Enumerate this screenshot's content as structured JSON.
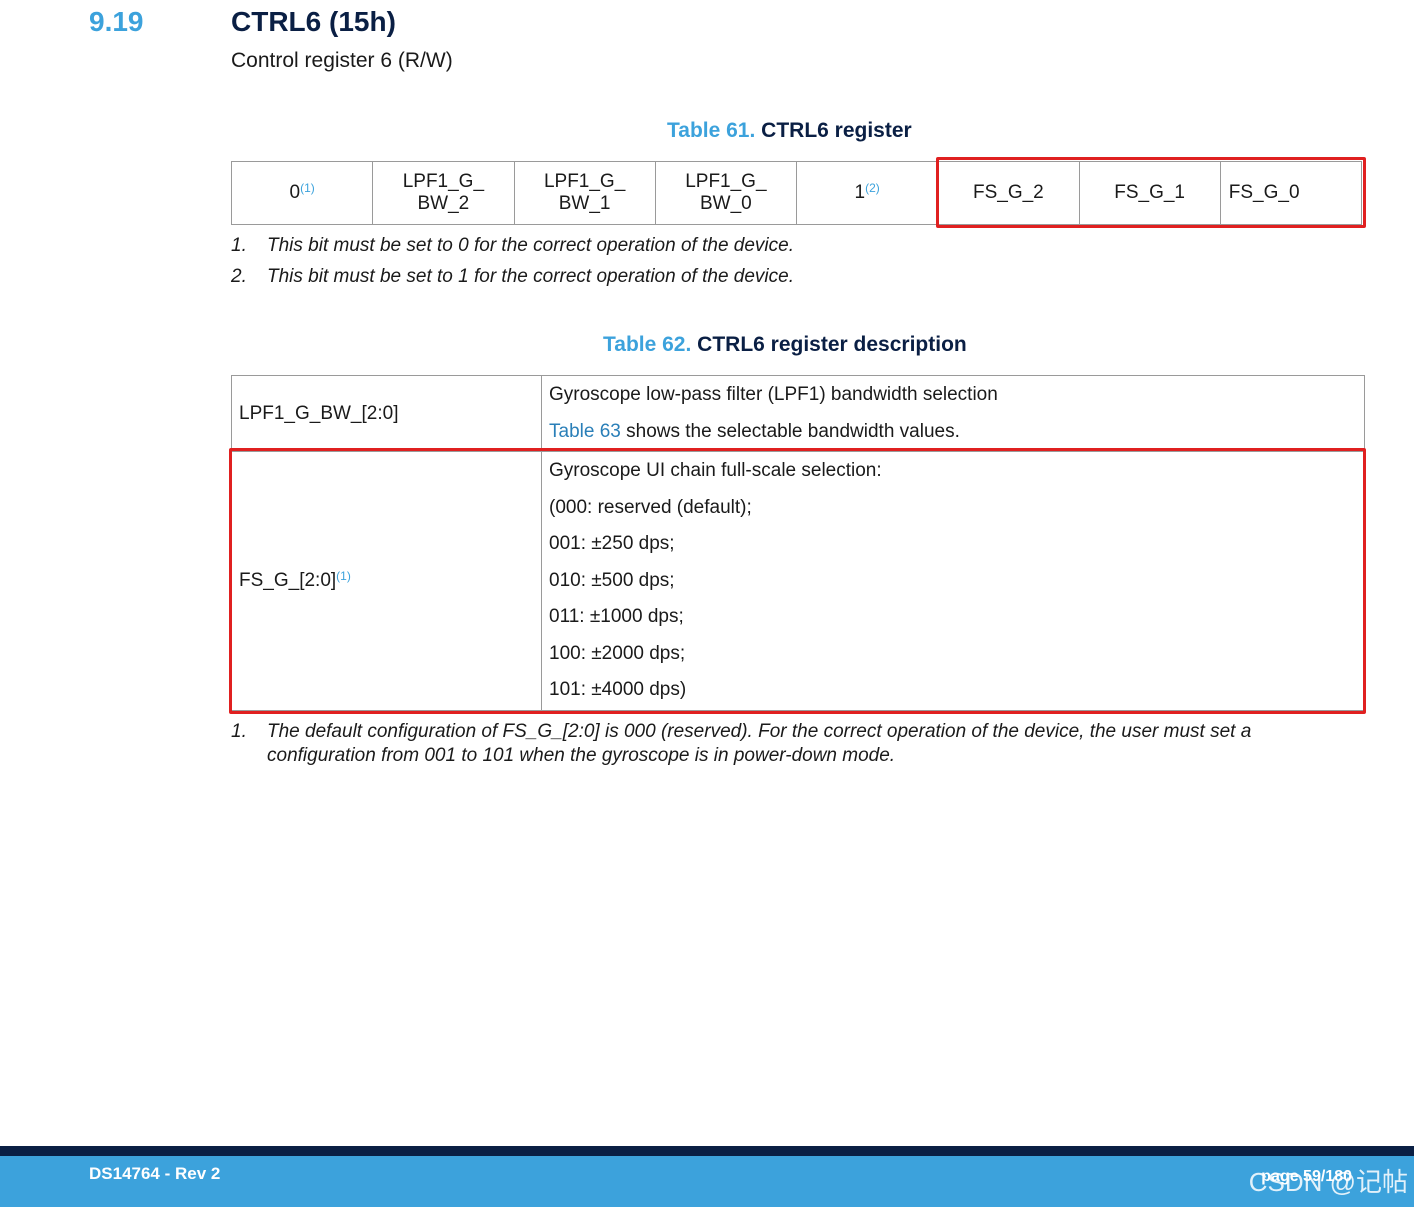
{
  "section": {
    "number": "9.19",
    "title": "CTRL6 (15h)",
    "subtitle": "Control register 6 (R/W)"
  },
  "table61": {
    "caption_num": "Table 61.",
    "caption_text": "CTRL6 register",
    "bits": [
      {
        "line1": "0",
        "line2": "",
        "sup": "(1)"
      },
      {
        "line1": "LPF1_G_",
        "line2": "BW_2",
        "sup": ""
      },
      {
        "line1": "LPF1_G_",
        "line2": "BW_1",
        "sup": ""
      },
      {
        "line1": "LPF1_G_",
        "line2": "BW_0",
        "sup": ""
      },
      {
        "line1": "1",
        "line2": "",
        "sup": "(2)"
      },
      {
        "line1": "FS_G_2",
        "line2": "",
        "sup": ""
      },
      {
        "line1": "FS_G_1",
        "line2": "",
        "sup": ""
      },
      {
        "line1": "FS_G_0",
        "line2": "",
        "sup": ""
      }
    ],
    "notes": [
      {
        "num": "1.",
        "text": "This bit must be set to 0 for the correct operation of the device."
      },
      {
        "num": "2.",
        "text": "This bit must be set to 1 for the correct operation of the device."
      }
    ]
  },
  "table62": {
    "caption_num": "Table 62.",
    "caption_text": "CTRL6 register description",
    "rows": [
      {
        "field": "LPF1_G_BW_[2:0]",
        "field_sup": "",
        "desc_line1": "Gyroscope low-pass filter (LPF1) bandwidth selection",
        "desc_link": "Table 63",
        "desc_line2_rest": " shows the selectable bandwidth values."
      },
      {
        "field": "FS_G_[2:0]",
        "field_sup": "(1)",
        "lines": [
          "Gyroscope UI chain full-scale selection:",
          "(000: reserved (default);",
          "001: ±250 dps;",
          "010: ±500 dps;",
          "011: ±1000 dps;",
          "100: ±2000 dps;",
          "101: ±4000 dps)"
        ]
      }
    ],
    "note": {
      "num": "1.",
      "line1": "The default configuration of FS_G_[2:0] is 000 (reserved). For the correct operation of the device, the user must set a",
      "line2": "configuration from 001 to 101 when the gyroscope is in power-down mode."
    }
  },
  "footer": {
    "doc": "DS14764 - Rev 2",
    "page": "page 59/180",
    "watermark": "CSDN @记帖"
  },
  "colors": {
    "accent": "#3ca2dc",
    "navy": "#0a1f44",
    "highlight": "#e02020"
  }
}
